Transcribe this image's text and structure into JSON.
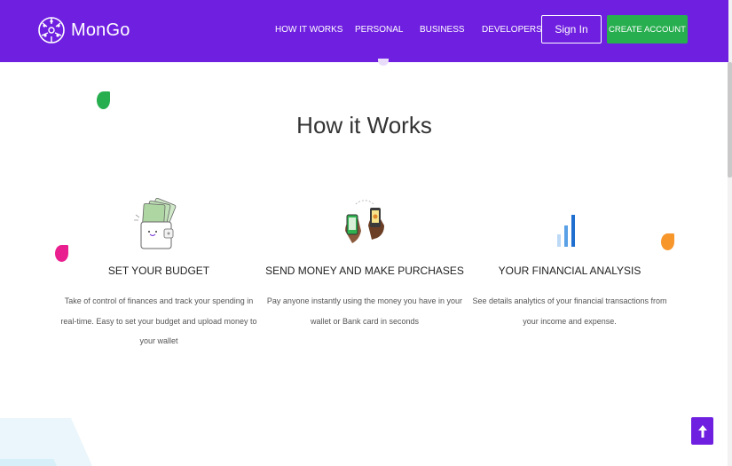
{
  "brand": {
    "name": "MonGo"
  },
  "nav": [
    {
      "label": "HOW IT WORKS"
    },
    {
      "label": "PERSONAL"
    },
    {
      "label": "BUSINESS"
    },
    {
      "label": "DEVELOPERS"
    }
  ],
  "header_buttons": {
    "signin": "Sign In",
    "create": "CREATE ACCOUNT"
  },
  "section": {
    "title": "How it Works"
  },
  "features": [
    {
      "title": "SET YOUR BUDGET",
      "desc": "Take of control of finances and track your spending in real-time. Easy to set your budget and upload money to your wallet",
      "icon": "wallet-money-icon"
    },
    {
      "title": "SEND MONEY AND MAKE PURCHASES",
      "desc": "Pay anyone instantly using the money you have in your wallet or Bank card in seconds",
      "icon": "phone-transfer-icon"
    },
    {
      "title": "YOUR FINANCIAL ANALYSIS",
      "desc": "See details analytics of your financial transactions from your income and expense.",
      "icon": "bar-chart-icon"
    }
  ],
  "back_to_top": {
    "icon": "arrow-up-icon"
  },
  "colors": {
    "primary": "#6f1fe0",
    "accent": "#27ae4f",
    "pink": "#e91e8f",
    "orange": "#f7962b"
  }
}
